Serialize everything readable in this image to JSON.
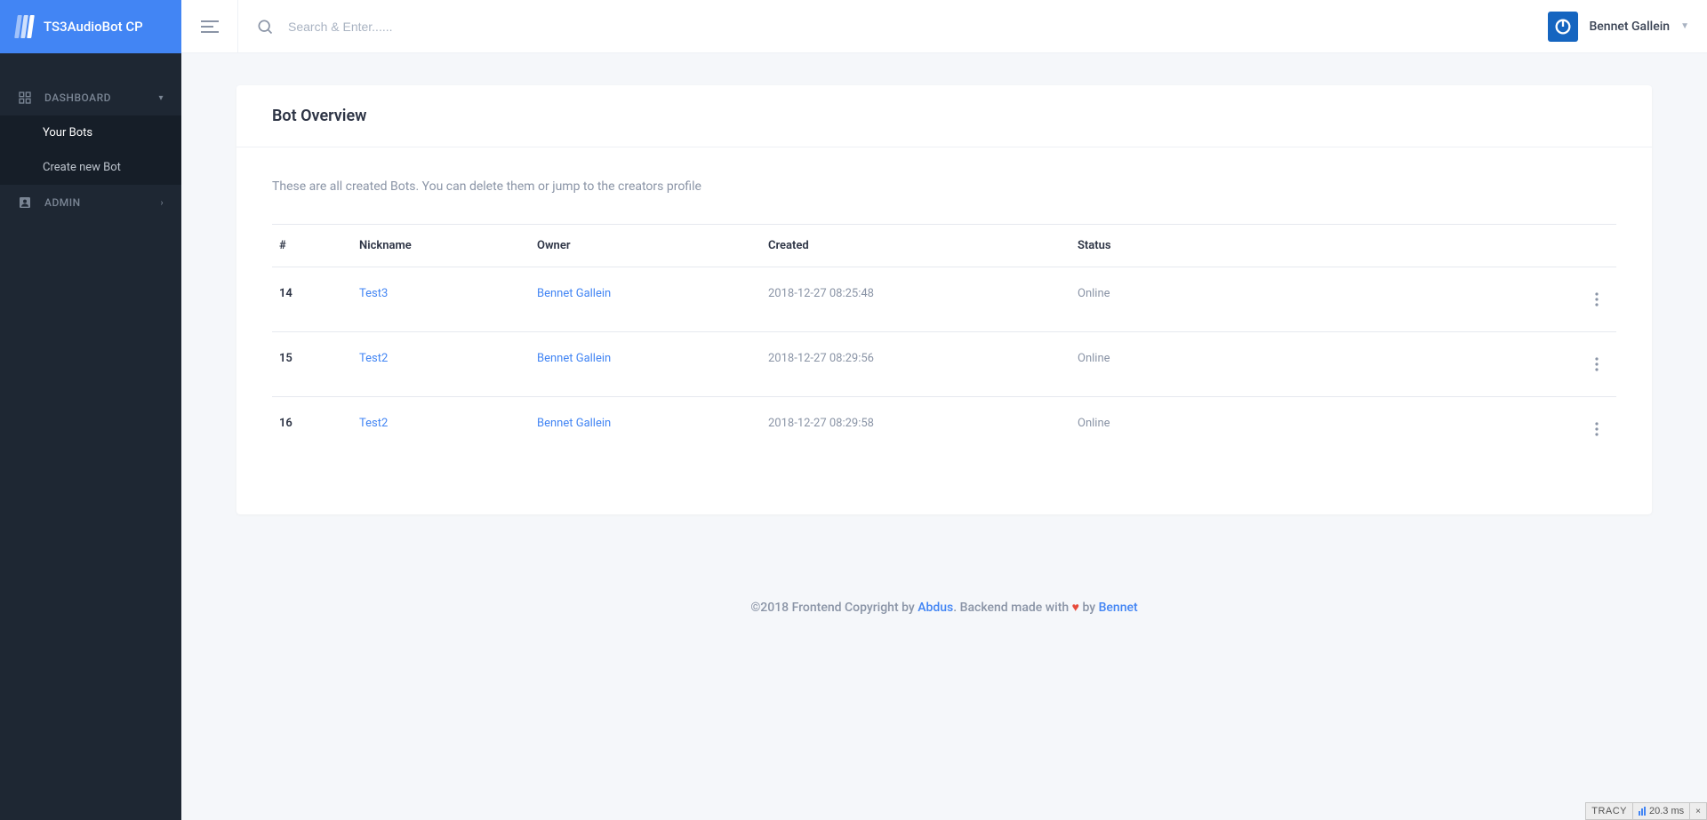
{
  "brand": {
    "title": "TS3AudioBot CP"
  },
  "header": {
    "search_placeholder": "Search & Enter......",
    "user_name": "Bennet Gallein"
  },
  "sidebar": {
    "dashboard_label": "DASHBOARD",
    "admin_label": "ADMIN",
    "sub": {
      "your_bots": "Your Bots",
      "create_bot": "Create new Bot"
    }
  },
  "page": {
    "title": "Bot Overview",
    "description": "These are all created Bots. You can delete them or jump to the creators profile"
  },
  "table": {
    "headers": {
      "id": "#",
      "nickname": "Nickname",
      "owner": "Owner",
      "created": "Created",
      "status": "Status"
    },
    "rows": [
      {
        "id": "14",
        "nickname": "Test3",
        "owner": "Bennet Gallein",
        "created": "2018-12-27 08:25:48",
        "status": "Online"
      },
      {
        "id": "15",
        "nickname": "Test2",
        "owner": "Bennet Gallein",
        "created": "2018-12-27 08:29:56",
        "status": "Online"
      },
      {
        "id": "16",
        "nickname": "Test2",
        "owner": "Bennet Gallein",
        "created": "2018-12-27 08:29:58",
        "status": "Online"
      }
    ]
  },
  "footer": {
    "prefix": "©2018 Frontend Copyright by ",
    "link1": "Abdus",
    "mid": ". Backend made with ",
    "heart": "♥",
    "by": " by ",
    "link2": "Bennet"
  },
  "tracy": {
    "label": "TRACY",
    "time": "20.3 ms",
    "close": "×"
  }
}
